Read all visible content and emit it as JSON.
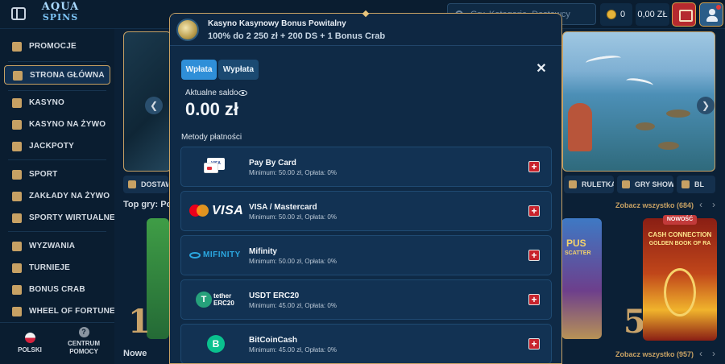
{
  "header": {
    "logo_line1": "AQUA",
    "logo_line2": "SPINS",
    "search_placeholder": "Gry, Kategorie, Dostawcy",
    "coins": "0",
    "balance": "0,00 ZŁ"
  },
  "sidebar": {
    "items": [
      {
        "label": "PROMOCJE",
        "icon": "gift-icon"
      },
      {
        "label": "STRONA GŁÓWNA",
        "icon": "home-icon"
      },
      {
        "label": "KASYNO",
        "icon": "slot-icon"
      },
      {
        "label": "KASYNO NA ŻYWO",
        "icon": "cards-icon"
      },
      {
        "label": "JACKPOTY",
        "icon": "clover-icon"
      },
      {
        "label": "SPORT",
        "icon": "ball-icon"
      },
      {
        "label": "ZAKŁADY NA ŻYWO",
        "icon": "live-icon"
      },
      {
        "label": "SPORTY WIRTUALNE",
        "icon": "controller-icon"
      },
      {
        "label": "WYZWANIA",
        "icon": "target-icon"
      },
      {
        "label": "TURNIEJE",
        "icon": "trophy-icon"
      },
      {
        "label": "BONUS CRAB",
        "icon": "crab-icon"
      },
      {
        "label": "WHEEL OF FORTUNE",
        "icon": "wheel-icon"
      }
    ],
    "active_index": 1,
    "language": "POLSKI",
    "help": "CENTRUM POMOCY"
  },
  "background": {
    "chips": [
      "DOSTAW",
      "RULETKA",
      "GRY SHOW",
      "BL"
    ],
    "top_games_title": "Top gry: Po",
    "see_all_top": "Zobacz wszystko (684)",
    "new_title": "Nowe",
    "see_all_new": "Zobacz wszystko (957)",
    "badge_new": "NOWOŚĆ",
    "tile_numbers": [
      "1",
      "5"
    ],
    "tile_titles": [
      "CASH CONNECTION",
      "GOLDEN BOOK OF RA",
      "PUS",
      "SCATTER"
    ]
  },
  "modal": {
    "promo_title": "Kasyno Kasynowy Bonus Powitalny",
    "promo_subtitle": "100% do 2 250 zł + 200 DS + 1 Bonus Crab",
    "tab_deposit": "Wpłata",
    "tab_withdraw": "Wypłata",
    "balance_label": "Aktualne saldo",
    "balance_value": "0.00 zł",
    "methods_label": "Metody płatności",
    "methods": [
      {
        "name": "Pay By Card",
        "info": "Minimum: 50.00 zł, Opłata: 0%",
        "logo": "paybycard-icon"
      },
      {
        "name": "VISA / Mastercard",
        "info": "Minimum: 50.00 zł, Opłata: 0%",
        "logo": "visa-mastercard-icon"
      },
      {
        "name": "Mifinity",
        "info": "Minimum: 50.00 zł, Opłata: 0%",
        "logo": "mifinity-icon"
      },
      {
        "name": "USDT ERC20",
        "info": "Minimum: 45.00 zł, Opłata: 0%",
        "logo": "tether-icon"
      },
      {
        "name": "BitCoinCash",
        "info": "Minimum: 45.00 zł, Opłata: 0%",
        "logo": "bitcoincash-icon"
      }
    ],
    "logo_text": {
      "card_small": "VISA",
      "visa": "VISA",
      "mifinity": "MIFINITY",
      "tether_line1": "tether",
      "tether_line2": "ERC20",
      "tether_symbol": "T",
      "bch_symbol": "B"
    }
  },
  "colors": {
    "gold": "#c7a164",
    "panel": "#0f2a46",
    "primary_tab": "#2f8fd8",
    "add_button": "#c8232c"
  }
}
